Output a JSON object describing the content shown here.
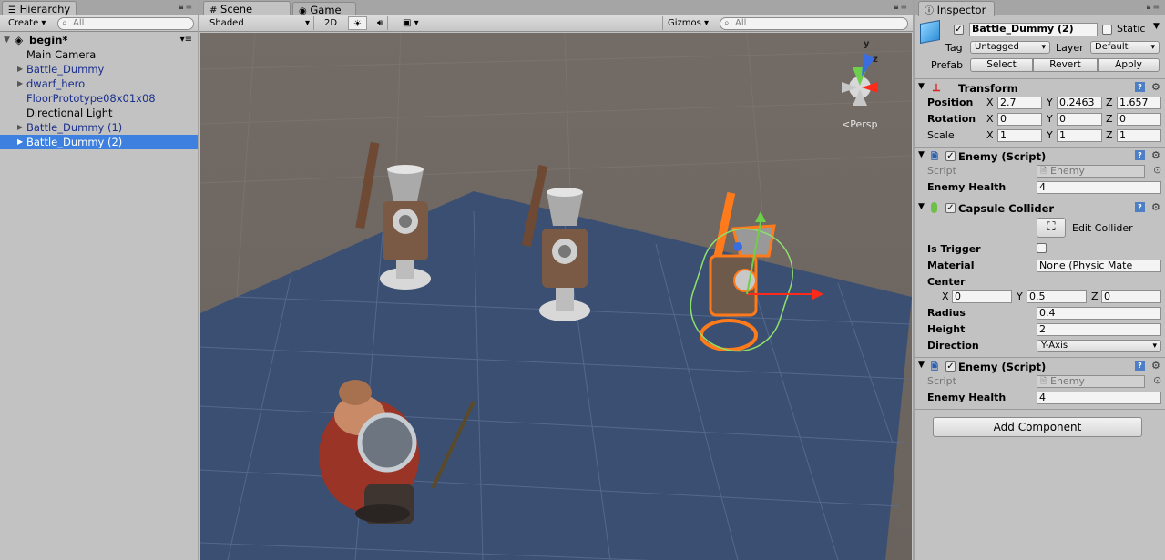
{
  "hierarchy": {
    "tab": "Hierarchy",
    "create_label": "Create",
    "search_placeholder": "All",
    "scene_name": "begin*",
    "items": [
      {
        "label": "Main Camera"
      },
      {
        "label": "Battle_Dummy"
      },
      {
        "label": "dwarf_hero"
      },
      {
        "label": "FloorPrototype08x01x08"
      },
      {
        "label": "Directional Light"
      },
      {
        "label": "Battle_Dummy (1)"
      },
      {
        "label": "Battle_Dummy (2)"
      }
    ]
  },
  "scene": {
    "tab_scene": "Scene",
    "tab_game": "Game",
    "shading": "Shaded",
    "mode_2d": "2D",
    "gizmos": "Gizmos",
    "search_placeholder": "All",
    "gizmo_axis_y": "y",
    "gizmo_axis_z": "z",
    "projection": "Persp",
    "colors": {
      "background": "#6f6863",
      "floor": "#3a5074",
      "selection": "#ff7a1a",
      "collider": "#8ee06c"
    }
  },
  "inspector": {
    "tab": "Inspector",
    "object_name": "Battle_Dummy (2)",
    "static_label": "Static",
    "tag_label": "Tag",
    "tag_value": "Untagged",
    "layer_label": "Layer",
    "layer_value": "Default",
    "prefab_label": "Prefab",
    "prefab_select": "Select",
    "prefab_revert": "Revert",
    "prefab_apply": "Apply",
    "transform": {
      "title": "Transform",
      "position_label": "Position",
      "rotation_label": "Rotation",
      "scale_label": "Scale",
      "axis_x": "X",
      "axis_y": "Y",
      "axis_z": "Z",
      "position": {
        "x": "2.7",
        "y": "0.2463",
        "z": "1.657"
      },
      "rotation": {
        "x": "0",
        "y": "0",
        "z": "0"
      },
      "scale": {
        "x": "1",
        "y": "1",
        "z": "1"
      }
    },
    "enemy_script_1": {
      "title": "Enemy (Script)",
      "script_label": "Script",
      "script_value": "Enemy",
      "health_label": "Enemy Health",
      "health_value": "4"
    },
    "capsule_collider": {
      "title": "Capsule Collider",
      "edit_collider": "Edit Collider",
      "is_trigger_label": "Is Trigger",
      "material_label": "Material",
      "material_value": "None (Physic Mate",
      "center_label": "Center",
      "center": {
        "x": "0",
        "y": "0.5",
        "z": "0"
      },
      "radius_label": "Radius",
      "radius_value": "0.4",
      "height_label": "Height",
      "height_value": "2",
      "direction_label": "Direction",
      "direction_value": "Y-Axis"
    },
    "enemy_script_2": {
      "title": "Enemy (Script)",
      "script_label": "Script",
      "script_value": "Enemy",
      "health_label": "Enemy Health",
      "health_value": "4"
    },
    "add_component": "Add Component"
  }
}
